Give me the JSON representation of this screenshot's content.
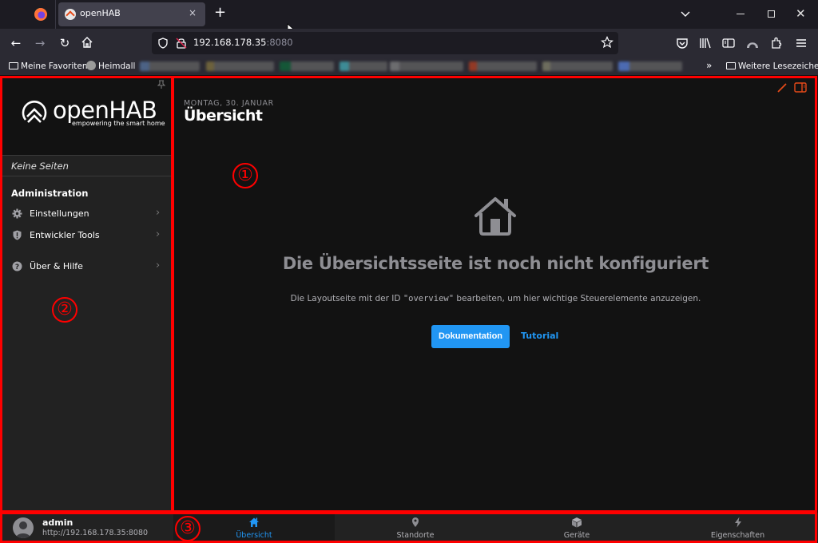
{
  "browser": {
    "tab_title": "openHAB",
    "tab_close": "×",
    "new_tab": "+",
    "url_host": "192.168.178.35",
    "url_port": ":8080",
    "nav": {
      "back": "←",
      "forward": "→",
      "reload": "↻",
      "home": "⌂"
    },
    "window_controls": {
      "minimize": "minimize",
      "maximize": "maximize",
      "close": "✕"
    },
    "bookmarks": [
      {
        "label": "Meine Favoriten",
        "icon": "folder-icon"
      },
      {
        "label": "Heimdall",
        "icon": "heimdall-favicon"
      }
    ],
    "bookmarks_more": "»",
    "bookmarks_other": "Weitere Lesezeichen"
  },
  "sidebar": {
    "logo_text": "openHAB",
    "logo_tagline": "empowering the smart home",
    "no_pages": "Keine Seiten",
    "section_title": "Administration",
    "items": [
      {
        "label": "Einstellungen",
        "icon": "gear-icon"
      },
      {
        "label": "Entwickler Tools",
        "icon": "shield-icon"
      },
      {
        "label": "Über & Hilfe",
        "icon": "help-icon"
      }
    ],
    "chevron": "›"
  },
  "main": {
    "date": "MONTAG, 30. JANUAR",
    "title": "Übersicht",
    "empty_title": "Die Übersichtsseite ist noch nicht konfiguriert",
    "empty_desc_pre": "Die Layoutseite mit der ID ",
    "empty_desc_code": "\"overview\"",
    "empty_desc_post": " bearbeiten, um hier wichtige Steuerelemente anzuzeigen.",
    "docs_button": "Dokumentation",
    "tutorial_link": "Tutorial"
  },
  "user": {
    "name": "admin",
    "url": "http://192.168.178.35:8080"
  },
  "bottom_tabs": [
    {
      "label": "Übersicht",
      "icon": "home-icon",
      "active": true
    },
    {
      "label": "Standorte",
      "icon": "location-pin-icon",
      "active": false
    },
    {
      "label": "Geräte",
      "icon": "cube-icon",
      "active": false
    },
    {
      "label": "Eigenschaften",
      "icon": "bolt-icon",
      "active": false
    }
  ],
  "annotations": [
    "①",
    "②",
    "③"
  ],
  "colors": {
    "accent": "#2196f3",
    "annotation": "#ff0000",
    "edit_icon": "#e64a19"
  }
}
